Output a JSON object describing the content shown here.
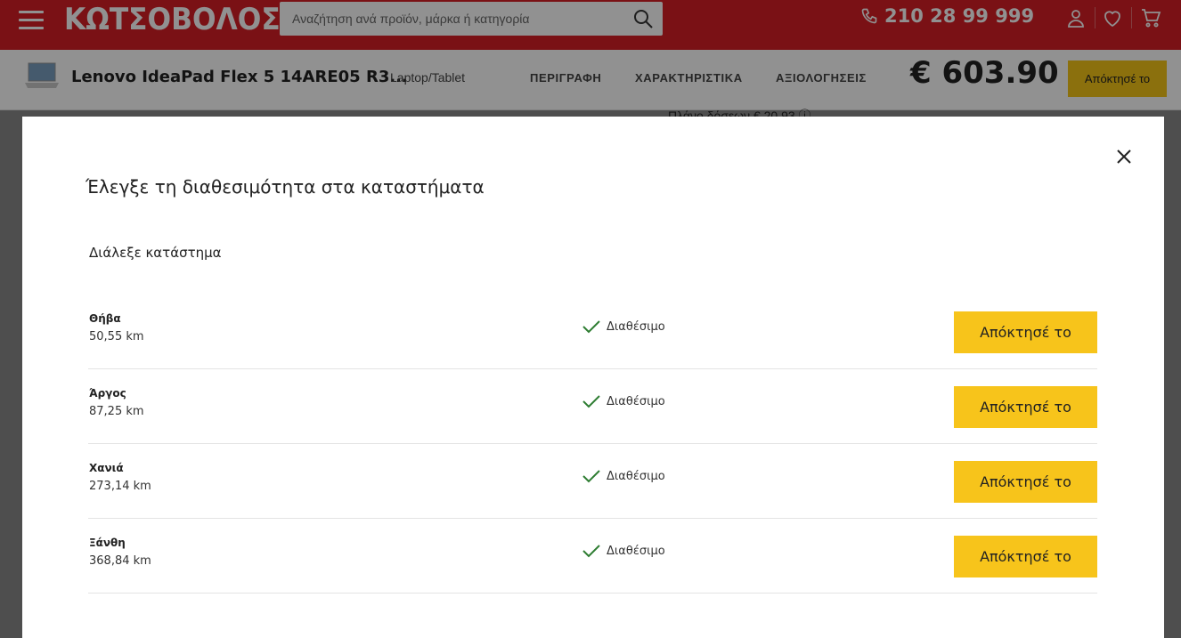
{
  "header": {
    "logo": "ΚΩΤΣΟΒΟΛΟΣ",
    "search_placeholder": "Αναζήτηση ανά προϊόν, μάρκα ή κατηγορία",
    "phone": "210 28 99 999"
  },
  "product_bar": {
    "title": "Lenovo IdeaPad Flex 5 14ARE05 R3...",
    "category": "Laptop/Tablet",
    "tabs": [
      "ΠΕΡΙΓΡΑΦΗ",
      "ΧΑΡΑΚΤΗΡΙΣΤΙΚΑ",
      "ΑΞΙΟΛΟΓΗΣΕΙΣ"
    ],
    "price": "€ 603.90",
    "buy_label": "Απόκτησέ το"
  },
  "background_peek": "Πλάνο δόσεων € 20.93 ⓘ",
  "modal": {
    "title": "Έλεγξε τη διαθεσιμότητα στα καταστήματα",
    "subtitle": "Διάλεξε κατάστημα",
    "stores": [
      {
        "name": "Θήβα",
        "distance": "50,55 km",
        "status": "Διαθέσιμο",
        "button": "Απόκτησέ το"
      },
      {
        "name": "Άργος",
        "distance": "87,25 km",
        "status": "Διαθέσιμο",
        "button": "Απόκτησέ το"
      },
      {
        "name": "Χανιά",
        "distance": "273,14 km",
        "status": "Διαθέσιμο",
        "button": "Απόκτησέ το"
      },
      {
        "name": "Ξάνθη",
        "distance": "368,84 km",
        "status": "Διαθέσιμο",
        "button": "Απόκτησέ το"
      }
    ]
  },
  "colors": {
    "brand_red": "#d61f26",
    "accent_yellow": "#f7c41b",
    "check_green": "#2e7d32"
  },
  "icons": {
    "menu": "hamburger-icon",
    "search": "search-icon",
    "phone": "phone-icon",
    "account": "user-icon",
    "wishlist": "heart-icon",
    "cart": "cart-icon",
    "close": "close-icon",
    "available": "check-icon"
  }
}
